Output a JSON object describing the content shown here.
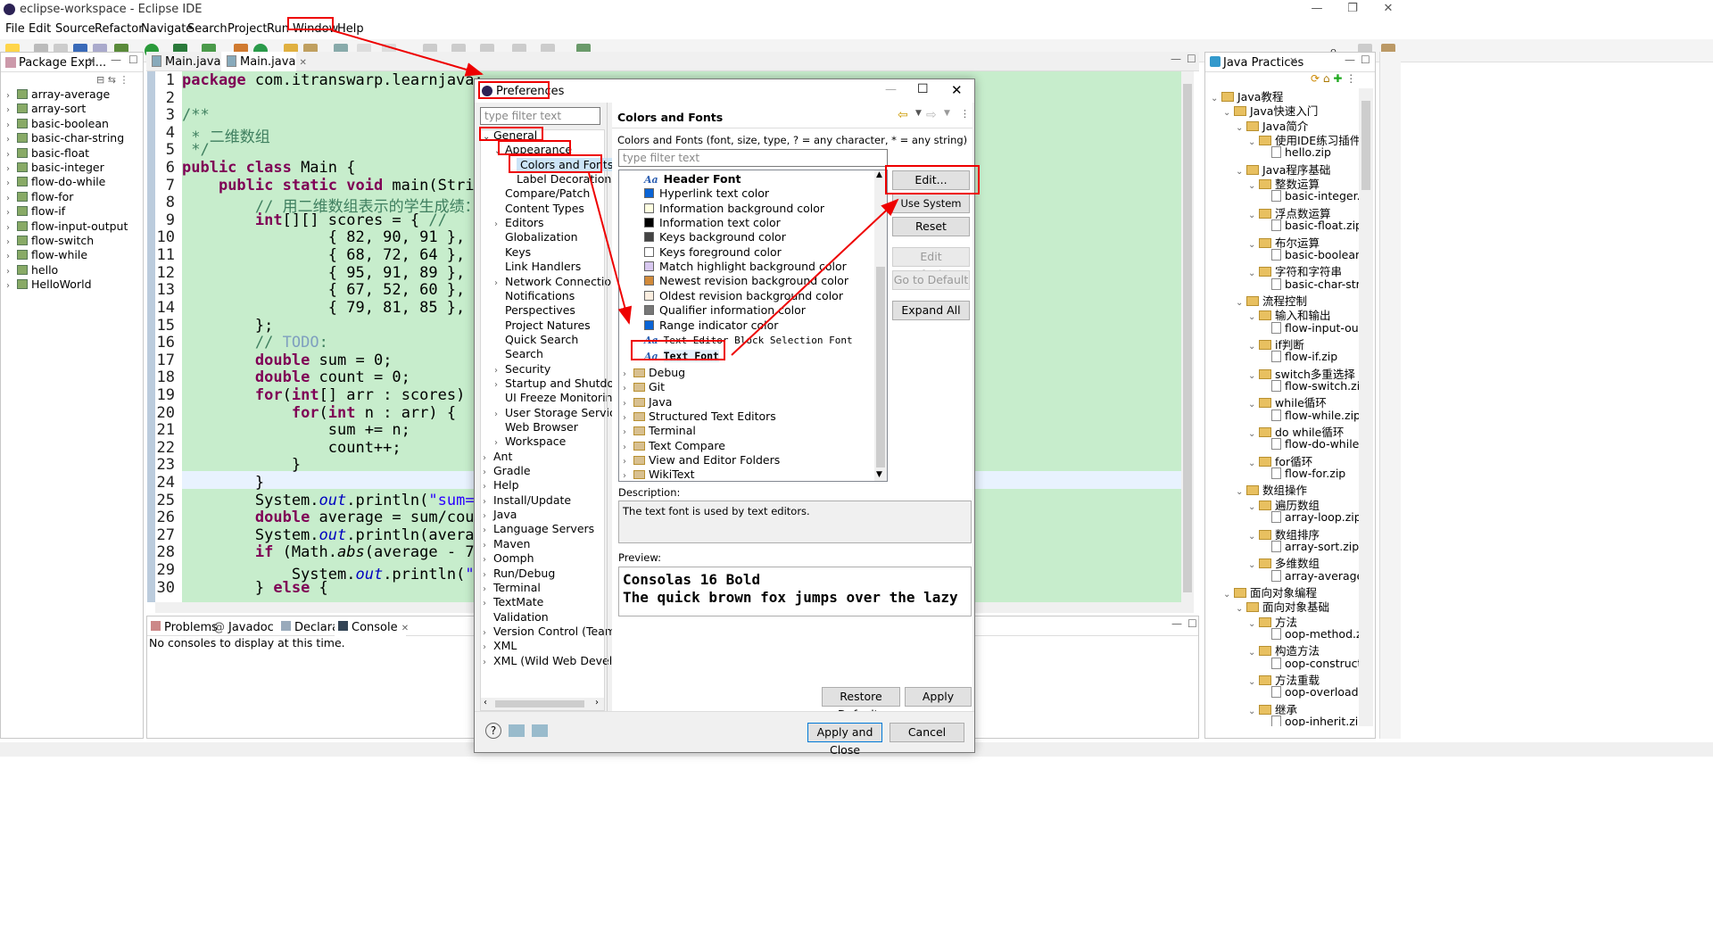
{
  "window": {
    "title": "eclipse-workspace - Eclipse IDE",
    "controls": [
      "—",
      "❐",
      "✕"
    ]
  },
  "menu": [
    "File",
    "Edit",
    "Source",
    "Refactor",
    "Navigate",
    "Search",
    "Project",
    "Run",
    "Window",
    "Help"
  ],
  "package_explorer": {
    "title": "Package Expl...",
    "items": [
      "array-average",
      "array-sort",
      "basic-boolean",
      "basic-char-string",
      "basic-float",
      "basic-integer",
      "flow-do-while",
      "flow-for",
      "flow-if",
      "flow-input-output",
      "flow-switch",
      "flow-while",
      "hello",
      "HelloWorld"
    ]
  },
  "editor": {
    "tabs": [
      "Main.java",
      "Main.java"
    ],
    "line_numbers": [
      "1",
      "2",
      "3",
      "4",
      "5",
      "6",
      "7",
      "8",
      "9",
      "10",
      "11",
      "12",
      "13",
      "14",
      "15",
      "16",
      "17",
      "18",
      "19",
      "20",
      "21",
      "22",
      "23",
      "24",
      "25",
      "26",
      "27",
      "28",
      "29",
      "30"
    ]
  },
  "bottom_panel": {
    "tabs": [
      "Problems",
      "Javadoc",
      "Declaration",
      "Console"
    ],
    "message": "No consoles to display at this time."
  },
  "java_practices": {
    "title": "Java Practices",
    "items": [
      {
        "label": "Java教程",
        "type": "folder",
        "level": 0
      },
      {
        "label": "Java快速入门",
        "type": "folder",
        "level": 1
      },
      {
        "label": "Java简介",
        "type": "folder",
        "level": 2
      },
      {
        "label": "使用IDE练习插件",
        "type": "folder",
        "level": 3
      },
      {
        "label": "hello.zip",
        "type": "file",
        "level": 4
      },
      {
        "label": "Java程序基础",
        "type": "folder",
        "level": 2
      },
      {
        "label": "整数运算",
        "type": "folder",
        "level": 3
      },
      {
        "label": "basic-integer.zip",
        "type": "file",
        "level": 4
      },
      {
        "label": "浮点数运算",
        "type": "folder",
        "level": 3
      },
      {
        "label": "basic-float.zip",
        "type": "file",
        "level": 4
      },
      {
        "label": "布尔运算",
        "type": "folder",
        "level": 3
      },
      {
        "label": "basic-boolean.zip",
        "type": "file",
        "level": 4
      },
      {
        "label": "字符和字符串",
        "type": "folder",
        "level": 3
      },
      {
        "label": "basic-char-string.zi",
        "type": "file",
        "level": 4
      },
      {
        "label": "流程控制",
        "type": "folder",
        "level": 2
      },
      {
        "label": "输入和输出",
        "type": "folder",
        "level": 3
      },
      {
        "label": "flow-input-output.z",
        "type": "file",
        "level": 4
      },
      {
        "label": "if判断",
        "type": "folder",
        "level": 3
      },
      {
        "label": "flow-if.zip",
        "type": "file",
        "level": 4
      },
      {
        "label": "switch多重选择",
        "type": "folder",
        "level": 3
      },
      {
        "label": "flow-switch.zip",
        "type": "file",
        "level": 4
      },
      {
        "label": "while循环",
        "type": "folder",
        "level": 3
      },
      {
        "label": "flow-while.zip",
        "type": "file",
        "level": 4
      },
      {
        "label": "do while循环",
        "type": "folder",
        "level": 3
      },
      {
        "label": "flow-do-while.zip",
        "type": "file",
        "level": 4
      },
      {
        "label": "for循环",
        "type": "folder",
        "level": 3
      },
      {
        "label": "flow-for.zip",
        "type": "file",
        "level": 4
      },
      {
        "label": "数组操作",
        "type": "folder",
        "level": 2
      },
      {
        "label": "遍历数组",
        "type": "folder",
        "level": 3
      },
      {
        "label": "array-loop.zip",
        "type": "file",
        "level": 4
      },
      {
        "label": "数组排序",
        "type": "folder",
        "level": 3
      },
      {
        "label": "array-sort.zip",
        "type": "file",
        "level": 4
      },
      {
        "label": "多维数组",
        "type": "folder",
        "level": 3
      },
      {
        "label": "array-average.zip",
        "type": "file",
        "level": 4
      },
      {
        "label": "面向对象编程",
        "type": "folder",
        "level": 1
      },
      {
        "label": "面向对象基础",
        "type": "folder",
        "level": 2
      },
      {
        "label": "方法",
        "type": "folder",
        "level": 3
      },
      {
        "label": "oop-method.zip",
        "type": "file",
        "level": 4
      },
      {
        "label": "构造方法",
        "type": "folder",
        "level": 3
      },
      {
        "label": "oop-constructor.zi",
        "type": "file",
        "level": 4
      },
      {
        "label": "方法重载",
        "type": "folder",
        "level": 3
      },
      {
        "label": "oop-overload.zip",
        "type": "file",
        "level": 4
      },
      {
        "label": "继承",
        "type": "folder",
        "level": 3
      },
      {
        "label": "oop-inherit.zip",
        "type": "file",
        "level": 4
      }
    ]
  },
  "preferences": {
    "title": "Preferences",
    "filter_placeholder": "type filter text",
    "tree": [
      {
        "label": "General",
        "level": 0,
        "arrow": "open"
      },
      {
        "label": "Appearance",
        "level": 1,
        "arrow": "open"
      },
      {
        "label": "Colors and Fonts",
        "level": 2,
        "arrow": ""
      },
      {
        "label": "Label Decorations",
        "level": 2,
        "arrow": ""
      },
      {
        "label": "Compare/Patch",
        "level": 1,
        "arrow": ""
      },
      {
        "label": "Content Types",
        "level": 1,
        "arrow": ""
      },
      {
        "label": "Editors",
        "level": 1,
        "arrow": "closed"
      },
      {
        "label": "Globalization",
        "level": 1,
        "arrow": ""
      },
      {
        "label": "Keys",
        "level": 1,
        "arrow": ""
      },
      {
        "label": "Link Handlers",
        "level": 1,
        "arrow": ""
      },
      {
        "label": "Network Connections",
        "level": 1,
        "arrow": "closed"
      },
      {
        "label": "Notifications",
        "level": 1,
        "arrow": ""
      },
      {
        "label": "Perspectives",
        "level": 1,
        "arrow": ""
      },
      {
        "label": "Project Natures",
        "level": 1,
        "arrow": ""
      },
      {
        "label": "Quick Search",
        "level": 1,
        "arrow": ""
      },
      {
        "label": "Search",
        "level": 1,
        "arrow": ""
      },
      {
        "label": "Security",
        "level": 1,
        "arrow": "closed"
      },
      {
        "label": "Startup and Shutdown",
        "level": 1,
        "arrow": "closed"
      },
      {
        "label": "UI Freeze Monitoring",
        "level": 1,
        "arrow": ""
      },
      {
        "label": "User Storage Service",
        "level": 1,
        "arrow": "closed"
      },
      {
        "label": "Web Browser",
        "level": 1,
        "arrow": ""
      },
      {
        "label": "Workspace",
        "level": 1,
        "arrow": "closed"
      },
      {
        "label": "Ant",
        "level": 0,
        "arrow": "closed"
      },
      {
        "label": "Gradle",
        "level": 0,
        "arrow": "closed"
      },
      {
        "label": "Help",
        "level": 0,
        "arrow": "closed"
      },
      {
        "label": "Install/Update",
        "level": 0,
        "arrow": "closed"
      },
      {
        "label": "Java",
        "level": 0,
        "arrow": "closed"
      },
      {
        "label": "Language Servers",
        "level": 0,
        "arrow": "closed"
      },
      {
        "label": "Maven",
        "level": 0,
        "arrow": "closed"
      },
      {
        "label": "Oomph",
        "level": 0,
        "arrow": "closed"
      },
      {
        "label": "Run/Debug",
        "level": 0,
        "arrow": "closed"
      },
      {
        "label": "Terminal",
        "level": 0,
        "arrow": "closed"
      },
      {
        "label": "TextMate",
        "level": 0,
        "arrow": "closed"
      },
      {
        "label": "Validation",
        "level": 0,
        "arrow": ""
      },
      {
        "label": "Version Control (Team)",
        "level": 0,
        "arrow": "closed"
      },
      {
        "label": "XML",
        "level": 0,
        "arrow": "closed"
      },
      {
        "label": "XML (Wild Web Develop",
        "level": 0,
        "arrow": "closed"
      }
    ],
    "page_title": "Colors and Fonts",
    "page_desc": "Colors and Fonts (font, size, type, ? = any character, * = any string) :",
    "font_list": [
      {
        "label": "Header Font",
        "kind": "font",
        "bold": true
      },
      {
        "label": "Hyperlink text color",
        "kind": "color",
        "color": "#0a64d6"
      },
      {
        "label": "Information background color",
        "kind": "color",
        "color": "#ffffe1"
      },
      {
        "label": "Information text color",
        "kind": "color",
        "color": "#000000"
      },
      {
        "label": "Keys background color",
        "kind": "color",
        "color": "#444444"
      },
      {
        "label": "Keys foreground color",
        "kind": "color",
        "color": "#ffffff"
      },
      {
        "label": "Match highlight background color",
        "kind": "color",
        "color": "#d8c8f0"
      },
      {
        "label": "Newest revision background color",
        "kind": "color",
        "color": "#d18a3a"
      },
      {
        "label": "Oldest revision background color",
        "kind": "color",
        "color": "#fbeee0"
      },
      {
        "label": "Qualifier information color",
        "kind": "color",
        "color": "#777777"
      },
      {
        "label": "Range indicator color",
        "kind": "color",
        "color": "#0a64d6"
      },
      {
        "label": "Text Editor Block Selection Font",
        "kind": "font-mono"
      },
      {
        "label": "Text Font",
        "kind": "font-mono-bold"
      }
    ],
    "font_groups": [
      "Debug",
      "Git",
      "Java",
      "Structured Text Editors",
      "Terminal",
      "Text Compare",
      "View and Editor Folders",
      "WikiText"
    ],
    "buttons": {
      "edit": "Edit...",
      "use_system_font": "Use System Font",
      "reset": "Reset",
      "edit_default": "Edit Default...",
      "go_to_default": "Go to Default",
      "expand_all": "Expand All",
      "restore_defaults": "Restore Defaults",
      "apply": "Apply",
      "apply_and_close": "Apply and Close",
      "cancel": "Cancel"
    },
    "description_label": "Description:",
    "description_text": "The text font is used by text editors.",
    "preview_label": "Preview:",
    "preview_line1": "Consolas 16 Bold",
    "preview_line2": "The quick brown fox jumps over the lazy"
  }
}
